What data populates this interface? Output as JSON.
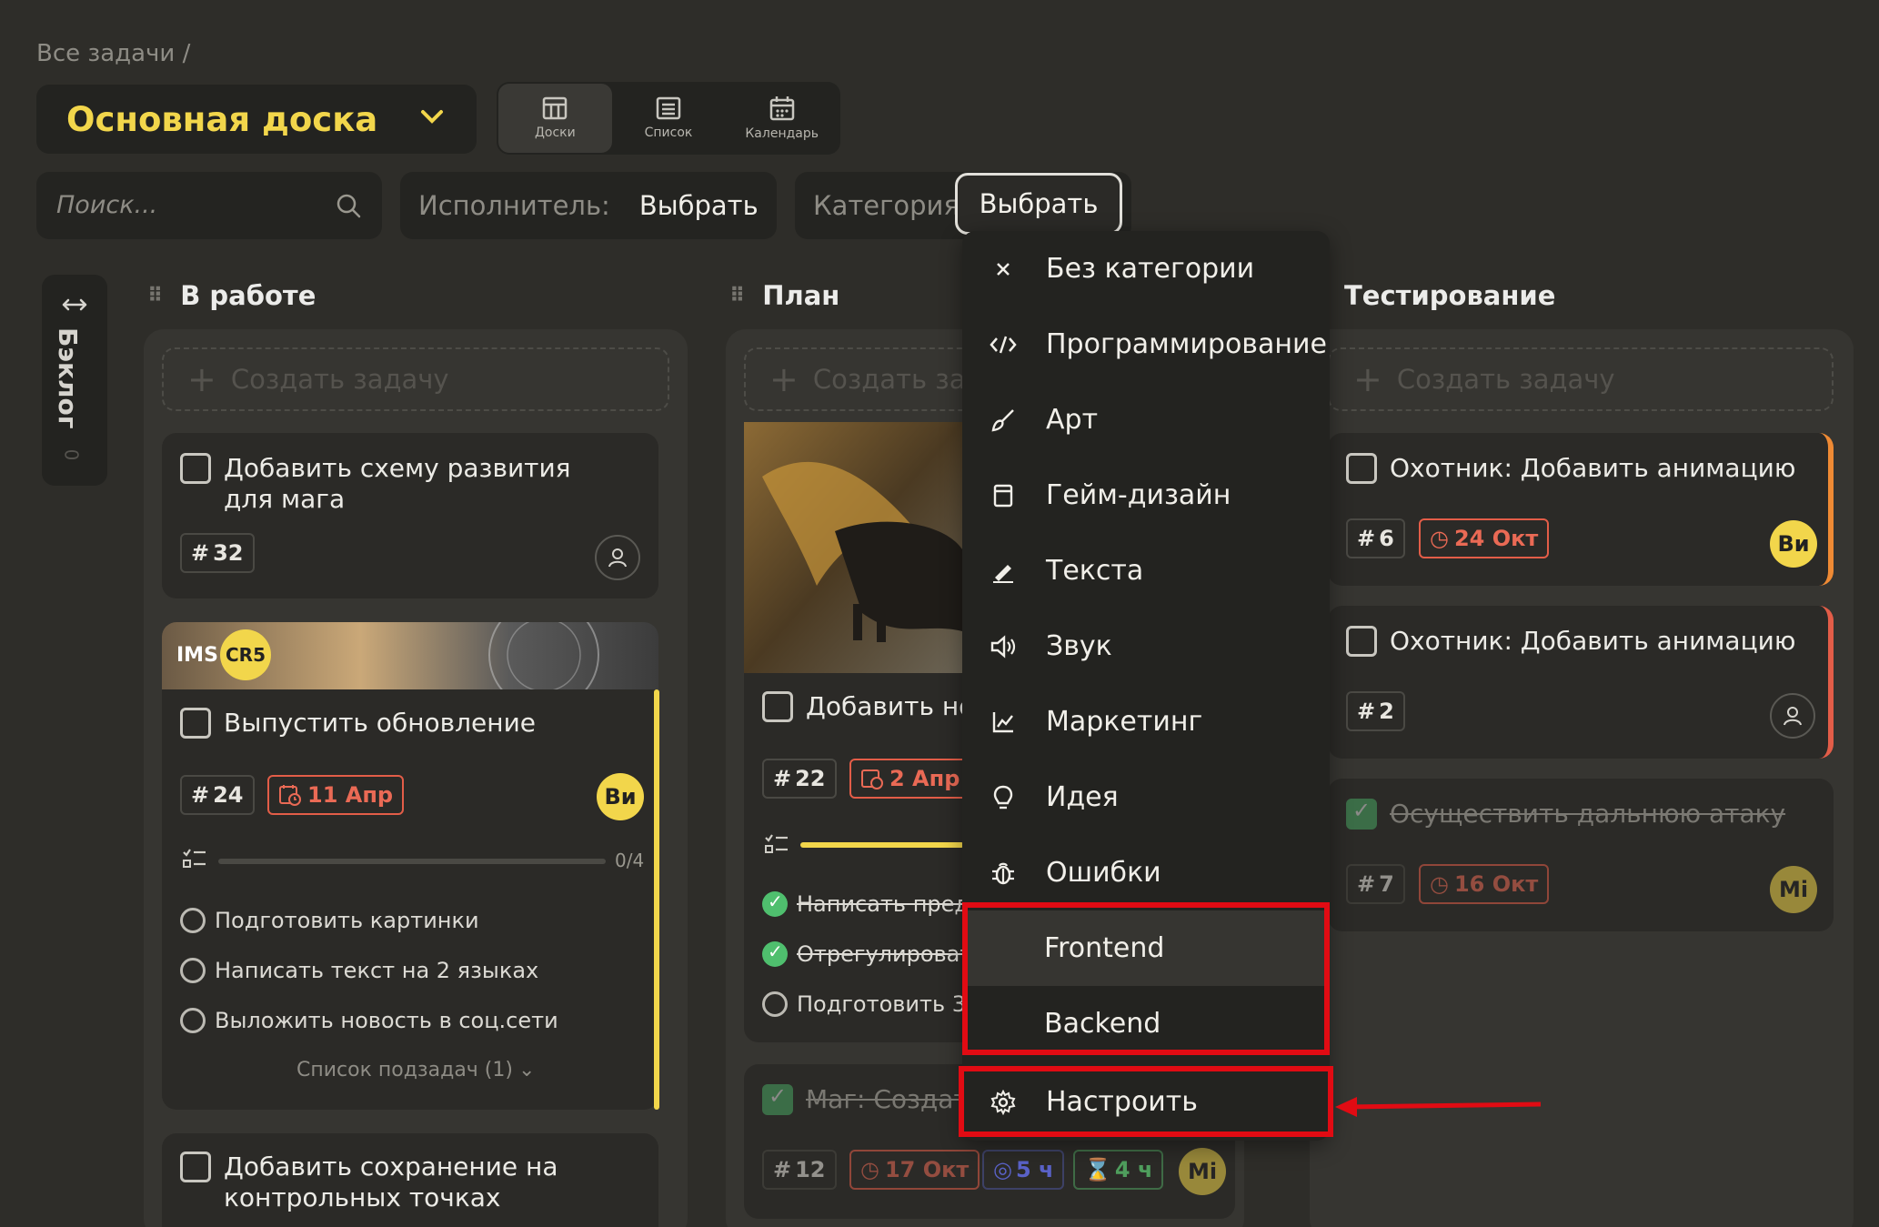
{
  "breadcrumb": "Все задачи /",
  "board": {
    "title": "Основная доска"
  },
  "views": [
    {
      "label": "Доски"
    },
    {
      "label": "Список"
    },
    {
      "label": "Календарь"
    }
  ],
  "search": {
    "placeholder": "Поиск..."
  },
  "filters": {
    "assignee": {
      "label": "Исполнитель:",
      "value": "Выбрать"
    },
    "category": {
      "label": "Категория:",
      "value": "Выбрать"
    }
  },
  "backlog": {
    "label": "Бэклог",
    "count": "0"
  },
  "columns": {
    "in_progress": {
      "title": "В работе",
      "create_label": "Создать задачу"
    },
    "plan": {
      "title": "План",
      "create_label": "Создать за"
    },
    "testing": {
      "title": "Тестирование",
      "create_label": "Создать задачу"
    }
  },
  "cards": {
    "c1": {
      "title": "Добавить схему развития для мага",
      "num": "32"
    },
    "c2": {
      "banner_text": "IMS",
      "banner_badge": "CR5",
      "title": "Выпустить обновление",
      "num": "24",
      "date": "11 Апр",
      "avatar": "Ви",
      "progress_text": "0/4",
      "progress_fraction": 0.0,
      "subtasks": [
        "Подготовить картинки",
        "Написать текст на 2 языках",
        "Выложить новость в соц.сети"
      ],
      "subtask_toggle": "Список подзадач (1)"
    },
    "c3": {
      "title": "Добавить сохранение на контрольных точках"
    },
    "p1": {
      "title": "Добавить нов",
      "num": "22",
      "date": "2 Апр",
      "subtasks": [
        "Написать предь",
        "Отрегулироват",
        "Подготовить 3D"
      ]
    },
    "p2": {
      "title": "Маг: Создать",
      "num": "12",
      "date": "17 Окт",
      "estimate": "5 ч",
      "spent": "4 ч",
      "avatar": "Mi"
    },
    "t1": {
      "title": "Охотник: Добавить анимацию",
      "num": "6",
      "date": "24 Окт",
      "avatar": "Ви"
    },
    "t2": {
      "title": "Охотник: Добавить анимацию",
      "num": "2"
    },
    "t3": {
      "title": "Осуществить дальнюю атаку",
      "num": "7",
      "date": "16 Окт",
      "avatar": "Mi"
    }
  },
  "category_menu": {
    "items": [
      {
        "label": "Без категории",
        "icon": "close-icon"
      },
      {
        "label": "Программирование",
        "icon": "code-icon"
      },
      {
        "label": "Арт",
        "icon": "brush-icon"
      },
      {
        "label": "Гейм-дизайн",
        "icon": "book-icon"
      },
      {
        "label": "Текста",
        "icon": "pen-icon"
      },
      {
        "label": "Звук",
        "icon": "speaker-icon"
      },
      {
        "label": "Маркетинг",
        "icon": "chart-icon"
      },
      {
        "label": "Идея",
        "icon": "bulb-icon"
      },
      {
        "label": "Ошибки",
        "icon": "bug-icon"
      },
      {
        "label": "Frontend",
        "icon": ""
      },
      {
        "label": "Backend",
        "icon": ""
      }
    ],
    "settings_label": "Настроить"
  },
  "colors": {
    "accent": "#f2d64b",
    "date_red": "#e35d48",
    "annotation_red": "#e10b13",
    "done_green": "#4fbf6e"
  }
}
